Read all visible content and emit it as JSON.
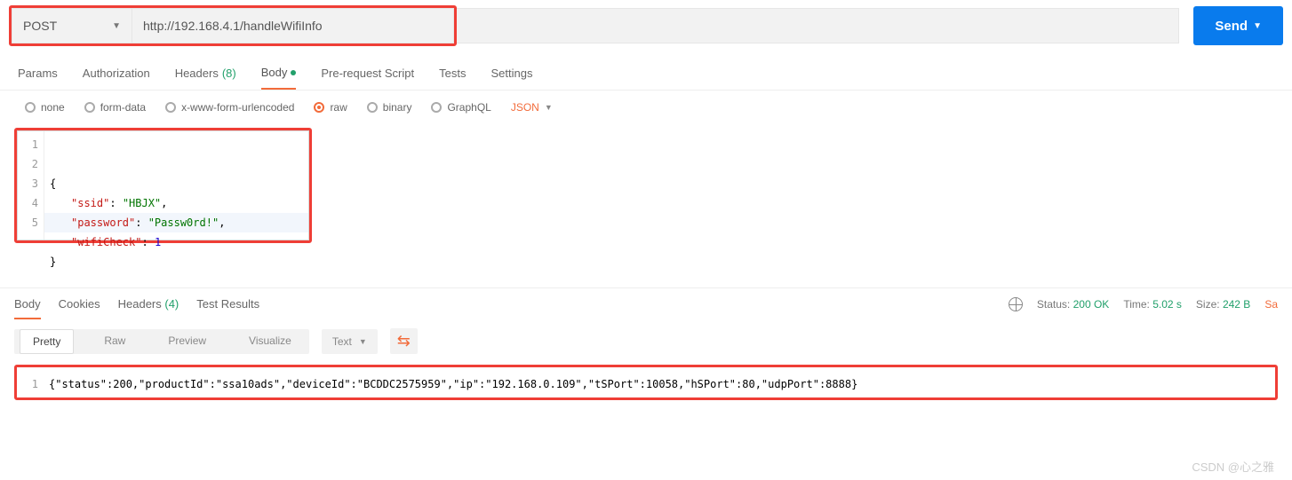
{
  "request": {
    "method": "POST",
    "url": "http://192.168.4.1/handleWifiInfo",
    "send_label": "Send"
  },
  "tabs": {
    "params": "Params",
    "authorization": "Authorization",
    "headers_label": "Headers",
    "headers_count": "(8)",
    "body": "Body",
    "prerequest": "Pre-request Script",
    "tests": "Tests",
    "settings": "Settings"
  },
  "body_types": {
    "none": "none",
    "formdata": "form-data",
    "xwww": "x-www-form-urlencoded",
    "raw": "raw",
    "binary": "binary",
    "graphql": "GraphQL",
    "json": "JSON"
  },
  "request_body": {
    "l1": "{",
    "l2_k": "\"ssid\"",
    "l2_v": "\"HBJX\"",
    "l3_k": "\"password\"",
    "l3_v": "\"Passw0rd!\"",
    "l4_k": "\"wifiCheck\"",
    "l4_v": "1",
    "l5": "}"
  },
  "response_tabs": {
    "body": "Body",
    "cookies": "Cookies",
    "headers_label": "Headers",
    "headers_count": "(4)",
    "test_results": "Test Results"
  },
  "status": {
    "status_label": "Status:",
    "status_value": "200 OK",
    "time_label": "Time:",
    "time_value": "5.02 s",
    "size_label": "Size:",
    "size_value": "242 B",
    "save_cut": "Sa"
  },
  "view_modes": {
    "pretty": "Pretty",
    "raw": "Raw",
    "preview": "Preview",
    "visualize": "Visualize",
    "text": "Text"
  },
  "response_body": "{\"status\":200,\"productId\":\"ssa10ads\",\"deviceId\":\"BCDDC2575959\",\"ip\":\"192.168.0.109\",\"tSPort\":10058,\"hSPort\":80,\"udpPort\":8888}",
  "watermark": "CSDN @心之雅"
}
